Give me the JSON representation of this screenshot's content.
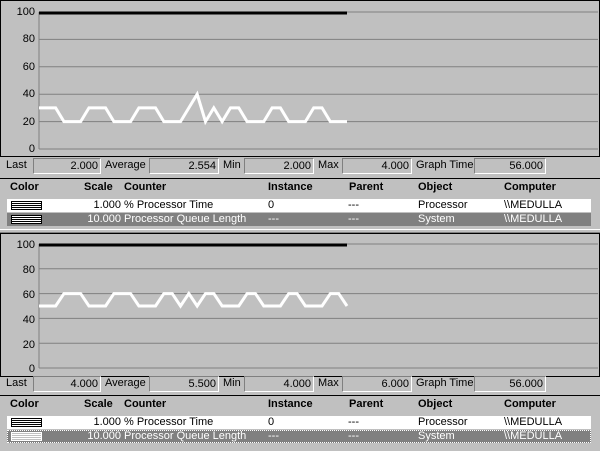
{
  "colors": {
    "line1": "#ffffff",
    "line2": "#000000",
    "grid": "#808080",
    "selected_row": "#808080"
  },
  "panes": [
    {
      "y_ticks": [
        "100",
        "80",
        "60",
        "40",
        "20",
        "0"
      ],
      "stats": {
        "last_label": "Last",
        "last": "2.000",
        "average_label": "Average",
        "average": "2.554",
        "min_label": "Min",
        "min": "2.000",
        "max_label": "Max",
        "max": "4.000",
        "graph_time_label": "Graph Time",
        "graph_time": "56.000"
      },
      "legend": {
        "headers": {
          "color": "Color",
          "scale": "Scale",
          "counter": "Counter",
          "instance": "Instance",
          "parent": "Parent",
          "object": "Object",
          "computer": "Computer"
        },
        "rows": [
          {
            "scale": "1.000",
            "counter": "% Processor Time",
            "instance": "0",
            "parent": "---",
            "object": "Processor",
            "computer": "\\\\MEDULLA"
          },
          {
            "scale": "10.000",
            "counter": "Processor Queue Length",
            "instance": "---",
            "parent": "---",
            "object": "System",
            "computer": "\\\\MEDULLA"
          }
        ]
      },
      "chart_data": {
        "type": "line",
        "ylim": [
          0,
          100
        ],
        "series": [
          {
            "values": [
              30,
              30,
              30,
              20,
              20,
              20,
              30,
              30,
              30,
              20,
              20,
              20,
              30,
              30,
              30,
              20,
              20,
              20,
              30,
              40,
              20,
              30,
              20,
              30,
              30,
              20,
              20,
              20,
              30,
              30,
              20,
              20,
              20,
              30,
              30,
              20,
              20,
              20
            ]
          },
          {
            "values": [
              100,
              100
            ]
          }
        ]
      }
    },
    {
      "y_ticks": [
        "100",
        "80",
        "60",
        "40",
        "20",
        "0"
      ],
      "stats": {
        "last_label": "Last",
        "last": "4.000",
        "average_label": "Average",
        "average": "5.500",
        "min_label": "Min",
        "min": "4.000",
        "max_label": "Max",
        "max": "6.000",
        "graph_time_label": "Graph Time",
        "graph_time": "56.000"
      },
      "legend": {
        "headers": {
          "color": "Color",
          "scale": "Scale",
          "counter": "Counter",
          "instance": "Instance",
          "parent": "Parent",
          "object": "Object",
          "computer": "Computer"
        },
        "rows": [
          {
            "scale": "1.000",
            "counter": "% Processor Time",
            "instance": "0",
            "parent": "---",
            "object": "Processor",
            "computer": "\\\\MEDULLA"
          },
          {
            "scale": "10.000",
            "counter": "Processor Queue Length",
            "instance": "---",
            "parent": "---",
            "object": "System",
            "computer": "\\\\MEDULLA"
          }
        ]
      },
      "chart_data": {
        "type": "line",
        "ylim": [
          0,
          100
        ],
        "series": [
          {
            "values": [
              50,
              50,
              50,
              60,
              60,
              60,
              50,
              50,
              50,
              60,
              60,
              60,
              50,
              50,
              50,
              60,
              60,
              50,
              60,
              50,
              60,
              60,
              50,
              50,
              50,
              60,
              60,
              50,
              50,
              50,
              60,
              60,
              50,
              50,
              50,
              60,
              60,
              50
            ]
          },
          {
            "values": [
              100,
              100
            ]
          }
        ]
      }
    }
  ]
}
